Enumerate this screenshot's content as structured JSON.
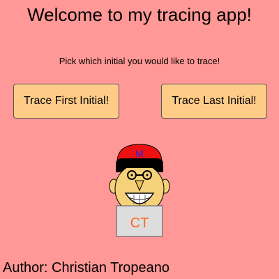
{
  "header": {
    "title": "Welcome to my tracing app!",
    "prompt": "Pick which initial you would like to trace!"
  },
  "buttons": {
    "first_label": "Trace First Initial!",
    "last_label": "Trace Last Initial!"
  },
  "mascot": {
    "hat_letter": "M",
    "shirt_text": "CT",
    "icon": "mascot-face-icon"
  },
  "footer": {
    "author": "Author: Christian Tropeano"
  },
  "colors": {
    "background": "#ff9896",
    "button": "#ffcc88",
    "hat": "#ee1111",
    "hat_letter": "#2222ee",
    "face": "#f5d27a",
    "shirt": "#dddddd",
    "shirt_text": "#ff6622"
  }
}
